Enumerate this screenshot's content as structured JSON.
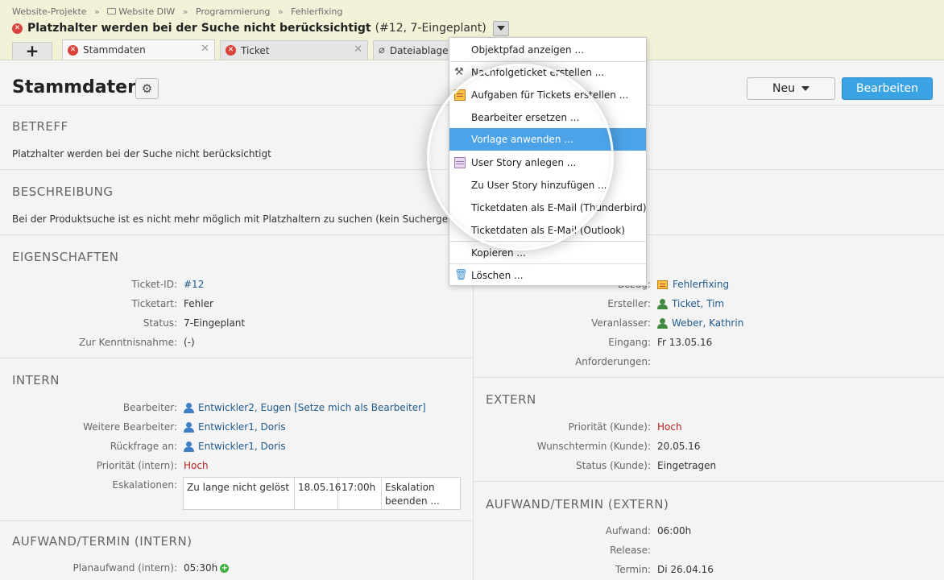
{
  "breadcrumb": [
    "Website-Projekte",
    "Website DIW",
    "Programmierung",
    "Fehlerfixing"
  ],
  "breadcrumb_sep": "»",
  "ticket": {
    "title": "Platzhalter werden bei der Suche nicht berücksichtigt",
    "meta": "(#12, 7-Eingeplant)"
  },
  "tabs": [
    {
      "label": "Stammdaten",
      "active": true
    },
    {
      "label": "Ticket"
    },
    {
      "label": "Dateiablage"
    }
  ],
  "tab_add": "+",
  "page": {
    "title": "Stammdaten",
    "new_label": "Neu",
    "edit_label": "Bearbeiten"
  },
  "betreff": {
    "heading": "BETREFF",
    "text": "Platzhalter werden bei der Suche nicht berücksichtigt"
  },
  "beschreibung": {
    "heading": "BESCHREIBUNG",
    "text": "Bei der Produktsuche ist es nicht mehr möglich mit Platzhaltern zu suchen (kein Suchergebnis)"
  },
  "eigenschaften": {
    "heading": "EIGENSCHAFTEN",
    "left": [
      {
        "label": "Ticket-ID:",
        "value": "#12"
      },
      {
        "label": "Ticketart:",
        "value": "Fehler"
      },
      {
        "label": "Status:",
        "value": "7-Eingeplant"
      },
      {
        "label": "Zur Kenntnisnahme:",
        "value": "(-)"
      }
    ],
    "right": [
      {
        "label": "Bezug:",
        "value": "Fehlerfixing"
      },
      {
        "label": "Ersteller:",
        "value": "Ticket, Tim"
      },
      {
        "label": "Veranlasser:",
        "value": "Weber, Kathrin"
      },
      {
        "label": "Eingang:",
        "value": "Fr 13.05.16"
      },
      {
        "label": "Anforderungen:",
        "value": ""
      }
    ]
  },
  "intern": {
    "heading": "INTERN",
    "rows": [
      {
        "label": "Bearbeiter:",
        "value": "Entwickler2, Eugen [Setze mich als Bearbeiter]"
      },
      {
        "label": "Weitere Bearbeiter:",
        "value": "Entwickler1, Doris"
      },
      {
        "label": "Rückfrage an:",
        "value": "Entwickler1, Doris"
      },
      {
        "label": "Priorität (intern):",
        "value": "Hoch"
      },
      {
        "label": "Eskalationen:",
        "value": ""
      }
    ],
    "eskalation": {
      "text": "Zu lange nicht gelöst",
      "date": "18.05.16",
      "time": "17:00h",
      "action": "Eskalation beenden ..."
    }
  },
  "extern": {
    "heading": "EXTERN",
    "rows": [
      {
        "label": "Priorität (Kunde):",
        "value": "Hoch"
      },
      {
        "label": "Wunschtermin (Kunde):",
        "value": "20.05.16"
      },
      {
        "label": "Status (Kunde):",
        "value": "Eingetragen"
      }
    ]
  },
  "aufwand_intern": {
    "heading": "AUFWAND/TERMIN (INTERN)",
    "rows": [
      {
        "label": "Planaufwand (intern):",
        "value": "05:30h"
      }
    ]
  },
  "aufwand_extern": {
    "heading": "AUFWAND/TERMIN (EXTERN)",
    "rows": [
      {
        "label": "Aufwand:",
        "value": "06:00h"
      },
      {
        "label": "Release:",
        "value": ""
      },
      {
        "label": "Termin:",
        "value": "Di 26.04.16"
      }
    ]
  },
  "menu": [
    {
      "label": "Objektpfad anzeigen ...",
      "icon": ""
    },
    {
      "label": "Nachfolgeticket erstellen ...",
      "icon": "tools-icon"
    },
    {
      "label": "Aufgaben für Tickets erstellen ...",
      "icon": "tasks-icon"
    },
    {
      "label": "Bearbeiter ersetzen ...",
      "icon": ""
    },
    {
      "label": "Vorlage anwenden ...",
      "icon": "",
      "highlighted": true
    },
    {
      "label": "User Story anlegen ...",
      "icon": "user-story-icon"
    },
    {
      "label": "Zu User Story hinzufügen ...",
      "icon": ""
    },
    {
      "label": "Ticketdaten als E-Mail (Thunderbird)",
      "icon": ""
    },
    {
      "label": "Ticketdaten als E-Mail (Outlook)",
      "icon": ""
    },
    {
      "label": "Kopieren ...",
      "icon": ""
    },
    {
      "label": "Löschen ...",
      "icon": "trash-icon"
    }
  ],
  "colors": {
    "accent": "#3aa3e3",
    "menu_highlight": "#4da3e8",
    "link": "#205a8c",
    "priority_high": "#b52222",
    "header_bg": "#f2f2d9"
  }
}
